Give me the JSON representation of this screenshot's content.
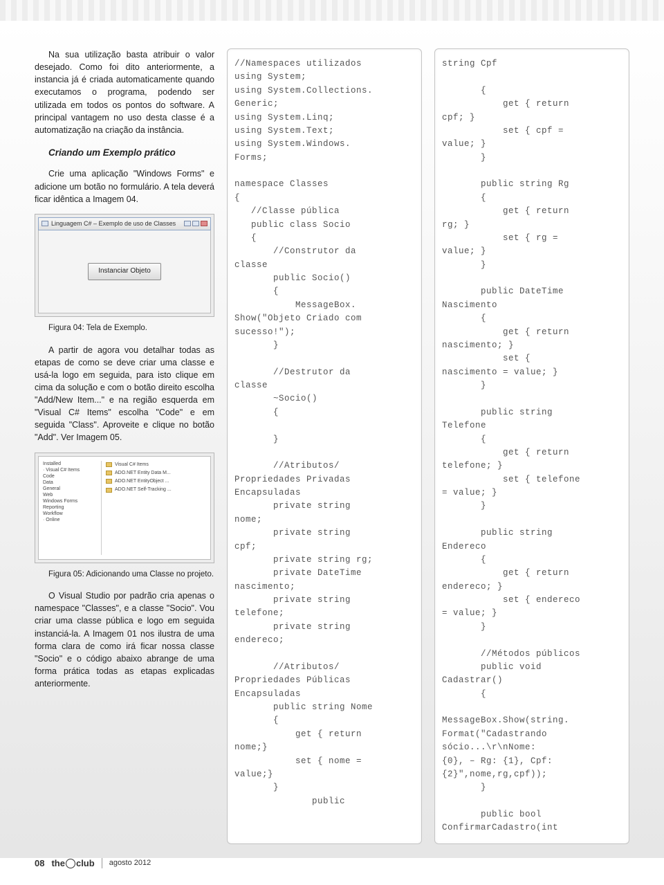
{
  "col1": {
    "p1": "Na sua utilização basta atribuir o valor desejado. Como foi dito anteriormente, a instancia já é criada automaticamente quando executamos o programa, podendo ser utilizada em todos os pontos do software. A principal vantagem no uso desta classe é a automatização na criação da instância.",
    "h1": "Criando um Exemplo prático",
    "p2": "Crie uma aplicação \"Windows Forms\" e adicione um botão no formulário. A tela deverá ficar idêntica a Imagem 04.",
    "img1": {
      "title": "Linguagem C# – Exemplo de uso de Classes",
      "button": "Instanciar Objeto"
    },
    "cap1": "Figura 04: Tela de Exemplo.",
    "p3": "A partir de agora vou detalhar todas as etapas de como se deve criar uma classe e usá-la logo em seguida, para isto clique em cima da solução e com o botão direito escolha \"Add/New Item...\" e na região esquerda em \"Visual C# Items\" escolha \"Code\" e em seguida \"Class\". Aproveite e clique no botão \"Add\". Ver Imagem 05.",
    "cap2": "Figura 05: Adicionando uma Classe no projeto.",
    "p4": "O Visual Studio por padrão cria apenas o namespace \"Classes\", e a classe \"Socio\". Vou criar uma classe pública e logo em seguida instanciá-la. A Imagem 01 nos ilustra de uma forma clara de como irá ficar nossa classe \"Socio\" e o código abaixo abrange de uma forma prática todas as etapas explicadas anteriormente.",
    "tree": [
      "Installed",
      "· Visual C# Items",
      "  Code",
      "  Data",
      "  General",
      "  Web",
      "  Windows Forms",
      "  Reporting",
      "  Workflow",
      "· Online"
    ],
    "files": [
      "Visual C# Items",
      "ADO.NET Entity Data M...",
      "ADO.NET EntityObject ...",
      "ADO.NET Self-Tracking ..."
    ]
  },
  "code_a": "//Namespaces utilizados\nusing System;\nusing System.Collections.\nGeneric;\nusing System.Linq;\nusing System.Text;\nusing System.Windows.\nForms;\n\nnamespace Classes\n{\n   //Classe pública\n   public class Socio\n   {\n       //Construtor da \nclasse\n       public Socio()\n       {\n           MessageBox.\nShow(\"Objeto Criado com \nsucesso!\");\n       }\n\n       //Destrutor da \nclasse\n       ~Socio()\n       {\n\n       }\n\n       //Atributos/\nPropriedades Privadas \nEncapsuladas\n       private string \nnome;\n       private string \ncpf;\n       private string rg;\n       private DateTime \nnascimento;\n       private string \ntelefone;\n       private string \nendereco;\n\n       //Atributos/\nPropriedades Públicas \nEncapsuladas\n       public string Nome\n       {\n           get { return \nnome;}\n           set { nome = \nvalue;}\n       }\n              public ",
  "code_b": "string Cpf\n\n       {\n           get { return \ncpf; }\n           set { cpf = \nvalue; }\n       }\n\n       public string Rg\n       {\n           get { return \nrg; }\n           set { rg = \nvalue; }\n       }\n\n       public DateTime \nNascimento\n       {\n           get { return \nnascimento; }\n           set { \nnascimento = value; }\n       }\n\n       public string \nTelefone\n       {\n           get { return \ntelefone; }\n           set { telefone \n= value; }\n       }\n\n       public string \nEndereco\n       {\n           get { return \nendereco; }\n           set { endereco \n= value; }\n       }\n\n       //Métodos públicos\n       public void \nCadastrar()\n       {\n           \nMessageBox.Show(string.\nFormat(\"Cadastrando \nsócio...\\r\\nNome:\n{0}, – Rg: {1}, Cpf: \n{2}\",nome,rg,cpf));\n       }\n\n       public bool \nConfirmarCadastro(int ",
  "footer": {
    "page": "08",
    "brand_a": "the",
    "brand_b": "club",
    "date": "agosto 2012"
  }
}
